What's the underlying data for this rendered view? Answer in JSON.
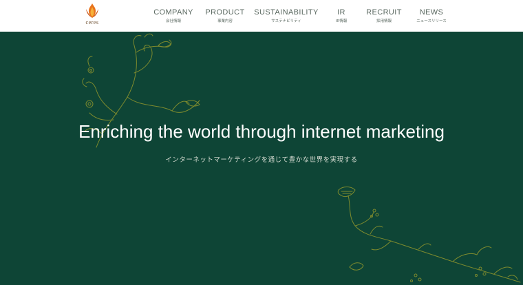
{
  "brand": {
    "name": "ceres",
    "accent": "#e8731c",
    "hero_bg": "#0e4536",
    "vine_color": "#7d8a2e"
  },
  "nav": [
    {
      "en": "COMPANY",
      "ja": "会社情報"
    },
    {
      "en": "PRODUCT",
      "ja": "事業内容"
    },
    {
      "en": "SUSTAINABILITY",
      "ja": "サステナビリティ"
    },
    {
      "en": "IR",
      "ja": "IR情報"
    },
    {
      "en": "RECRUIT",
      "ja": "採用情報"
    },
    {
      "en": "NEWS",
      "ja": "ニュースリリース"
    }
  ],
  "hero": {
    "title": "Enriching the world through internet marketing",
    "subtitle": "インターネットマーケティングを通じて豊かな世界を実現する"
  }
}
